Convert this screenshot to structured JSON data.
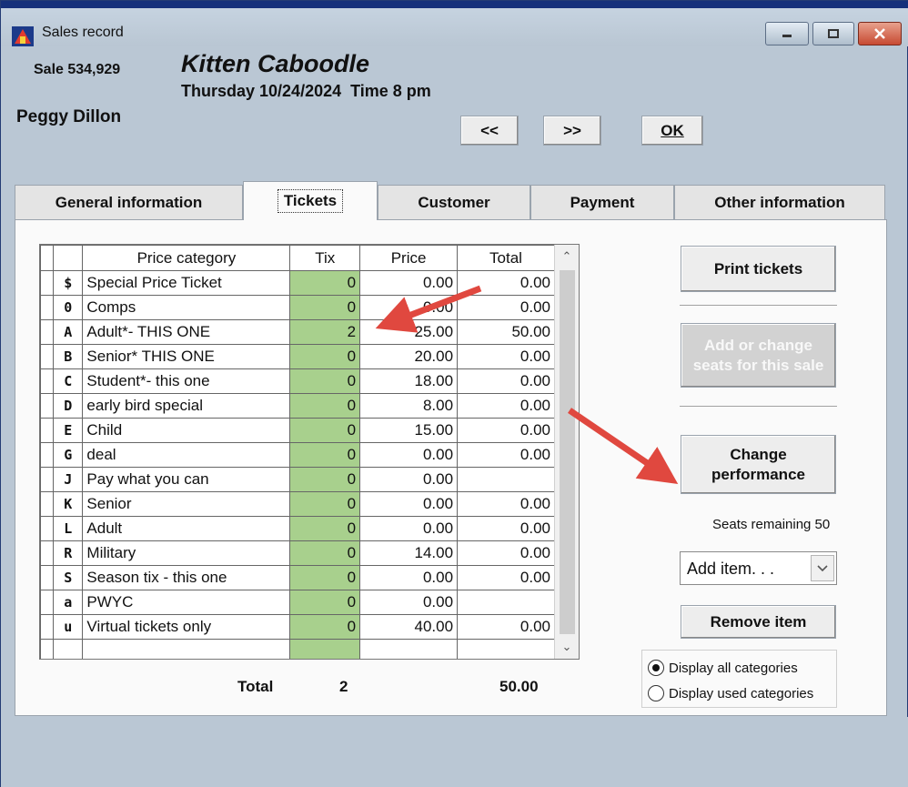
{
  "window": {
    "title": "Sales record"
  },
  "header": {
    "sale_number": "Sale 534,929",
    "show_title": "Kitten Caboodle",
    "show_datetime": "Thursday 10/24/2024  Time 8 pm",
    "customer_name": "Peggy Dillon"
  },
  "nav": {
    "prev": "<<",
    "next": ">>",
    "ok": "OK"
  },
  "tabs": [
    {
      "label": "General information"
    },
    {
      "label": "Tickets"
    },
    {
      "label": "Customer"
    },
    {
      "label": "Payment"
    },
    {
      "label": "Other information"
    }
  ],
  "grid": {
    "columns": [
      "Price category",
      "Tix",
      "Price",
      "Total"
    ],
    "rows": [
      {
        "code": "$",
        "category": "Special Price Ticket",
        "tix": "0",
        "price": "0.00",
        "total": "0.00"
      },
      {
        "code": "0",
        "category": "Comps",
        "tix": "0",
        "price": "0.00",
        "total": "0.00"
      },
      {
        "code": "A",
        "category": "Adult*- THIS ONE",
        "tix": "2",
        "price": "25.00",
        "total": "50.00"
      },
      {
        "code": "B",
        "category": "Senior* THIS ONE",
        "tix": "0",
        "price": "20.00",
        "total": "0.00"
      },
      {
        "code": "C",
        "category": "Student*- this one",
        "tix": "0",
        "price": "18.00",
        "total": "0.00"
      },
      {
        "code": "D",
        "category": "early bird special",
        "tix": "0",
        "price": "8.00",
        "total": "0.00"
      },
      {
        "code": "E",
        "category": "Child",
        "tix": "0",
        "price": "15.00",
        "total": "0.00"
      },
      {
        "code": "G",
        "category": "deal",
        "tix": "0",
        "price": "0.00",
        "total": "0.00"
      },
      {
        "code": "J",
        "category": "Pay what you can",
        "tix": "0",
        "price": "0.00",
        "total": ""
      },
      {
        "code": "K",
        "category": "Senior",
        "tix": "0",
        "price": "0.00",
        "total": "0.00"
      },
      {
        "code": "L",
        "category": "Adult",
        "tix": "0",
        "price": "0.00",
        "total": "0.00"
      },
      {
        "code": "R",
        "category": "Military",
        "tix": "0",
        "price": "14.00",
        "total": "0.00"
      },
      {
        "code": "S",
        "category": "Season tix - this one",
        "tix": "0",
        "price": "0.00",
        "total": "0.00"
      },
      {
        "code": "a",
        "category": "PWYC",
        "tix": "0",
        "price": "0.00",
        "total": ""
      },
      {
        "code": "u",
        "category": "Virtual tickets only",
        "tix": "0",
        "price": "40.00",
        "total": "0.00"
      },
      {
        "code": "",
        "category": "",
        "tix": "",
        "price": "",
        "total": ""
      }
    ]
  },
  "totals": {
    "label": "Total",
    "tix": "2",
    "total": "50.00"
  },
  "side": {
    "print_tickets": "Print tickets",
    "add_change_line1": "Add or change",
    "add_change_line2": "seats for this sale",
    "change_perf_line1": "Change",
    "change_perf_line2": "performance",
    "seats_remaining": "Seats remaining 50",
    "add_item": "Add item. . .",
    "remove_item": "Remove item",
    "display_all": "Display all categories",
    "display_used": "Display used categories"
  },
  "colors": {
    "tix_cell": "#a8d08d",
    "annotation_arrow": "#e0483f",
    "window_bg": "#bac7d4"
  }
}
